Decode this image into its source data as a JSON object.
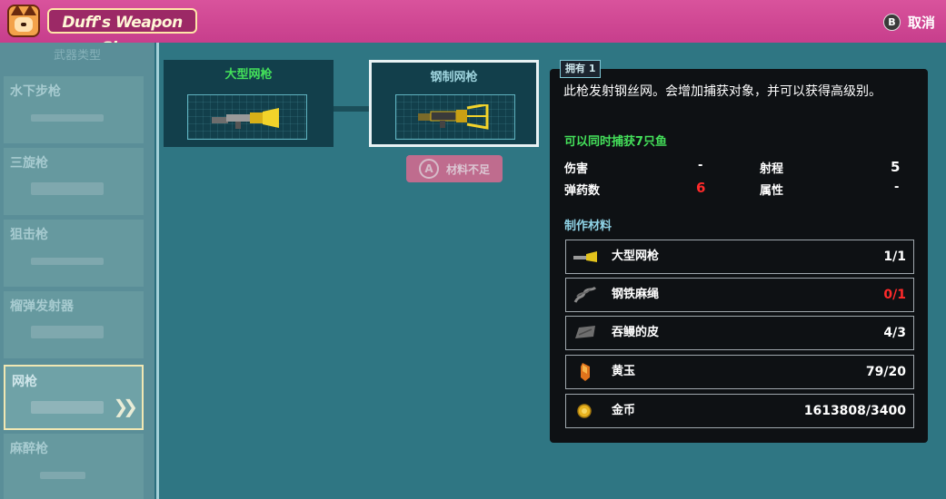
{
  "header": {
    "title": "Duff's Weapon Shop",
    "cancel_key": "B",
    "cancel_label": "取消"
  },
  "sidebar": {
    "header": "武器类型",
    "items": [
      {
        "label": "水下步枪"
      },
      {
        "label": "三旋枪"
      },
      {
        "label": "狙击枪"
      },
      {
        "label": "榴弹发射器"
      },
      {
        "label": "网枪",
        "active": true
      },
      {
        "label": "麻醉枪"
      }
    ]
  },
  "upgrade_tree": {
    "from": {
      "name": "大型网枪"
    },
    "to": {
      "name": "钢制网枪"
    },
    "craft_key": "A",
    "craft_label": "材料不足"
  },
  "details": {
    "owned": "拥有 1",
    "description": "此枪发射钢丝网。会增加捕获对象，并可以获得高级别。",
    "feature": "可以同时捕获7只鱼",
    "stats": [
      {
        "label": "伤害",
        "value": "-"
      },
      {
        "label": "射程",
        "value": "5"
      },
      {
        "label": "弹药数",
        "value": "6",
        "color": "#ff2a2a"
      },
      {
        "label": "属性",
        "value": "-"
      }
    ],
    "materials_title": "制作材料",
    "materials": [
      {
        "icon": "net-gun-icon",
        "name": "大型网枪",
        "count": "1/1"
      },
      {
        "icon": "rope-icon",
        "name": "钢铁麻绳",
        "count": "0/1",
        "color": "#ff2a2a"
      },
      {
        "icon": "eel-skin-icon",
        "name": "吞鳗的皮",
        "count": "4/3"
      },
      {
        "icon": "topaz-icon",
        "name": "黄玉",
        "count": "79/20"
      },
      {
        "icon": "gold-coin-icon",
        "name": "金币",
        "count": "1613808/3400"
      }
    ]
  },
  "colors": {
    "header_pink": "#d9539c",
    "green_text": "#44e05a",
    "red_text": "#ff2a2a",
    "panel_bg": "#0e1114"
  }
}
